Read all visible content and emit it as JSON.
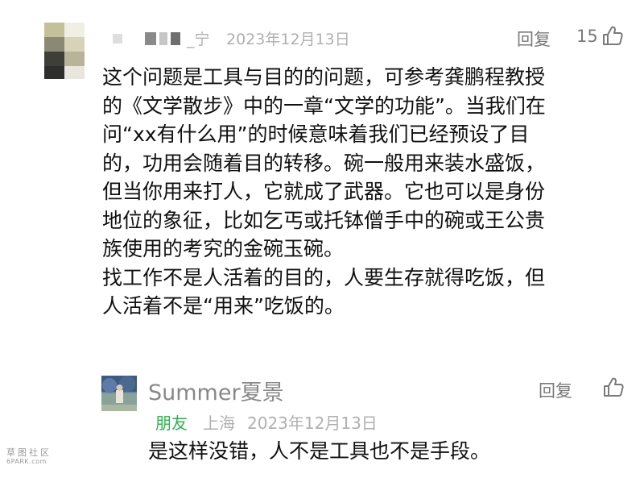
{
  "main_comment": {
    "username": "_宁",
    "date": "2023年12月13日",
    "reply_label": "回复",
    "like_count": "15",
    "content_lines": [
      "这个问题是工具与目的的问题，可参考龚鹏程教授",
      "的《文学散步》中的一章“文学的功能”。当我们在",
      "问“xx有什么用”的时候意味着我们已经预设了目",
      "的，功用会随着目的转移。碗一般用来装水盛饭，",
      "但当你用来打人，它就成了武器。它也可以是身份",
      "地位的象征，比如乞丐或托钵僧手中的碗或王公贵",
      "族使用的考究的金碗玉碗。",
      "找工作不是人活着的目的，人要生存就得吃饭，但",
      "人活着不是“用来”吃饭的。"
    ]
  },
  "reply_comment": {
    "username": "Summer夏景",
    "badge": "朋友",
    "location": "上海",
    "date": "2023年12月13日",
    "reply_label": "回复",
    "content": "是这样没错，人不是工具也不是手段。"
  },
  "watermark": {
    "line1": "草图社区",
    "line2": "6PARK.com"
  },
  "colors": {
    "badge_green": "#2bb24c",
    "meta_gray": "#b0b0b0",
    "action_gray": "#7a7a7a"
  },
  "icons": {
    "like": "thumbs-up-icon"
  }
}
